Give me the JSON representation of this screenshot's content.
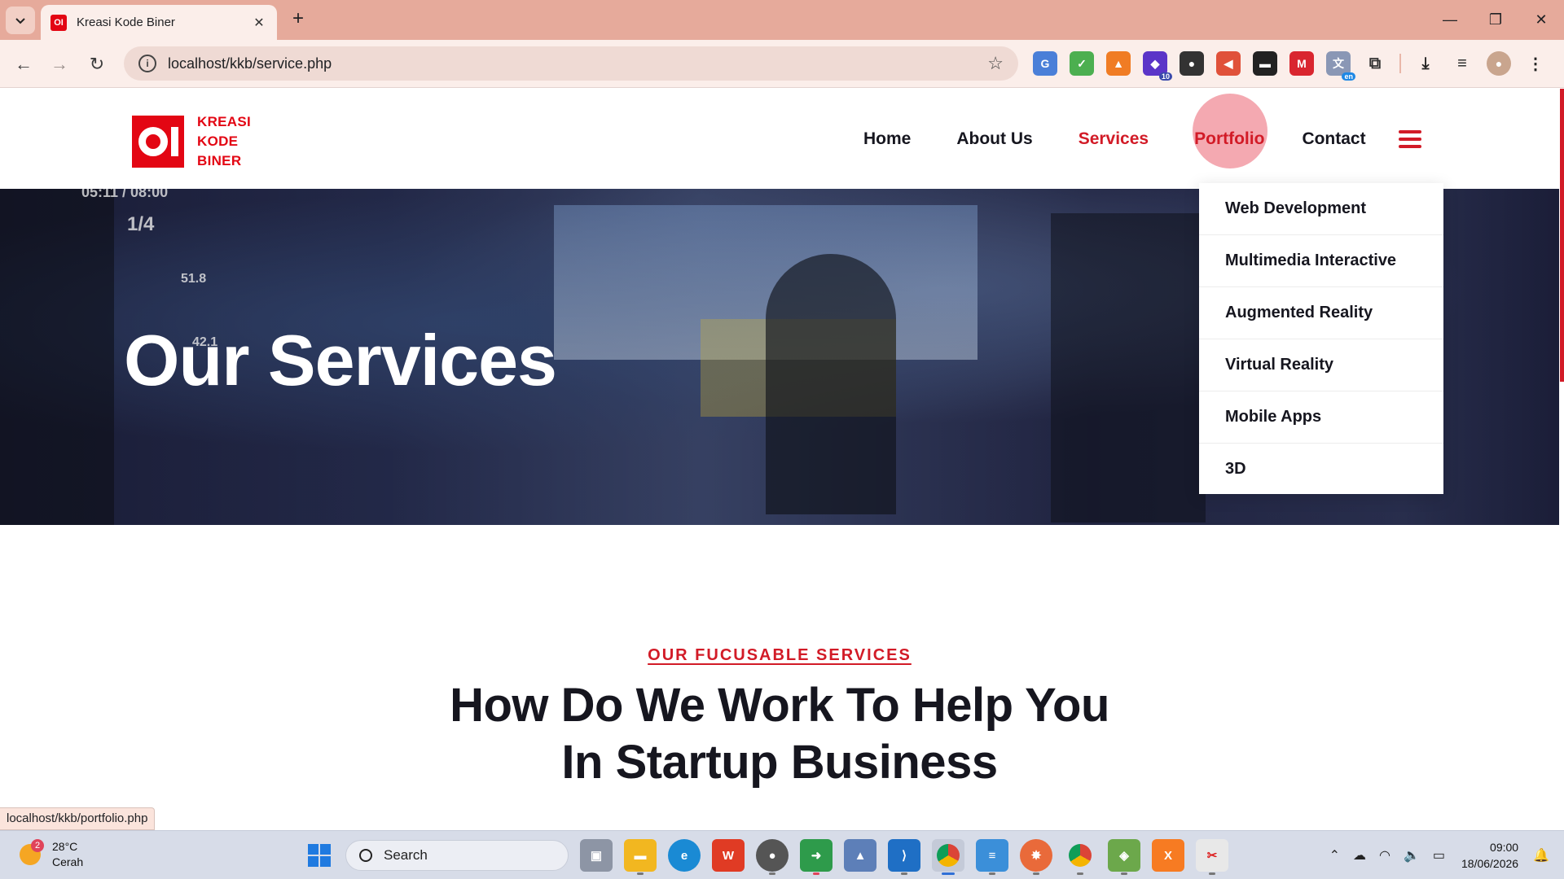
{
  "browser": {
    "tab_title": "Kreasi Kode Biner",
    "url": "localhost/kkb/service.php",
    "status_url": "localhost/kkb/portfolio.php",
    "extension_badge": "10",
    "extension_lang": "en"
  },
  "site": {
    "logo_line1": "KREASI",
    "logo_line2": "KODE",
    "logo_line3": "BINER",
    "nav": {
      "home": "Home",
      "about": "About Us",
      "services": "Services",
      "portfolio": "Portfolio",
      "contact": "Contact"
    },
    "dropdown": [
      "Web Development",
      "Multimedia Interactive",
      "Augmented Reality",
      "Virtual Reality",
      "Mobile Apps",
      "3D"
    ],
    "hero_title": "Our Services",
    "hero_hud": {
      "time": "05:11 / 08:00",
      "count": "1/4",
      "speed": "51.8",
      "other": "42.1"
    },
    "section_subtitle": "OUR FUCUSABLE SERVICES",
    "section_heading_line1": "How Do We Work To Help You",
    "section_heading_line2": "In Startup Business"
  },
  "colors": {
    "brand": "#e30613",
    "accent": "#d21b27",
    "hover_circle": "#f4a9b1",
    "chrome": "#e6aa9b"
  },
  "taskbar": {
    "weather_badge": "2",
    "temperature": "28°C",
    "condition": "Cerah",
    "search_label": "Search",
    "time": "09:00",
    "date": "18/06/2026"
  }
}
